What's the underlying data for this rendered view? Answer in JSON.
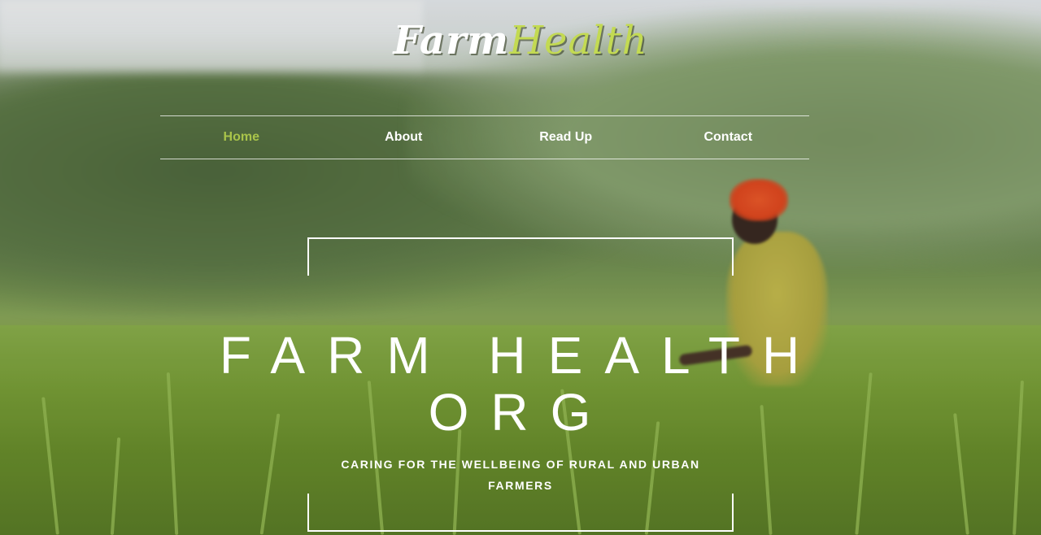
{
  "logo": {
    "part1": "Farm",
    "part2": "Health"
  },
  "nav": {
    "items": [
      {
        "label": "Home",
        "active": true
      },
      {
        "label": "About",
        "active": false
      },
      {
        "label": "Read Up",
        "active": false
      },
      {
        "label": "Contact",
        "active": false
      }
    ]
  },
  "hero": {
    "title": "FARM HEALTH ORG",
    "tagline": "CARING FOR THE WELLBEING OF RURAL AND URBAN FARMERS"
  },
  "colors": {
    "accent": "#a9c44a",
    "logo_health": "#c3da52",
    "text": "#ffffff"
  }
}
